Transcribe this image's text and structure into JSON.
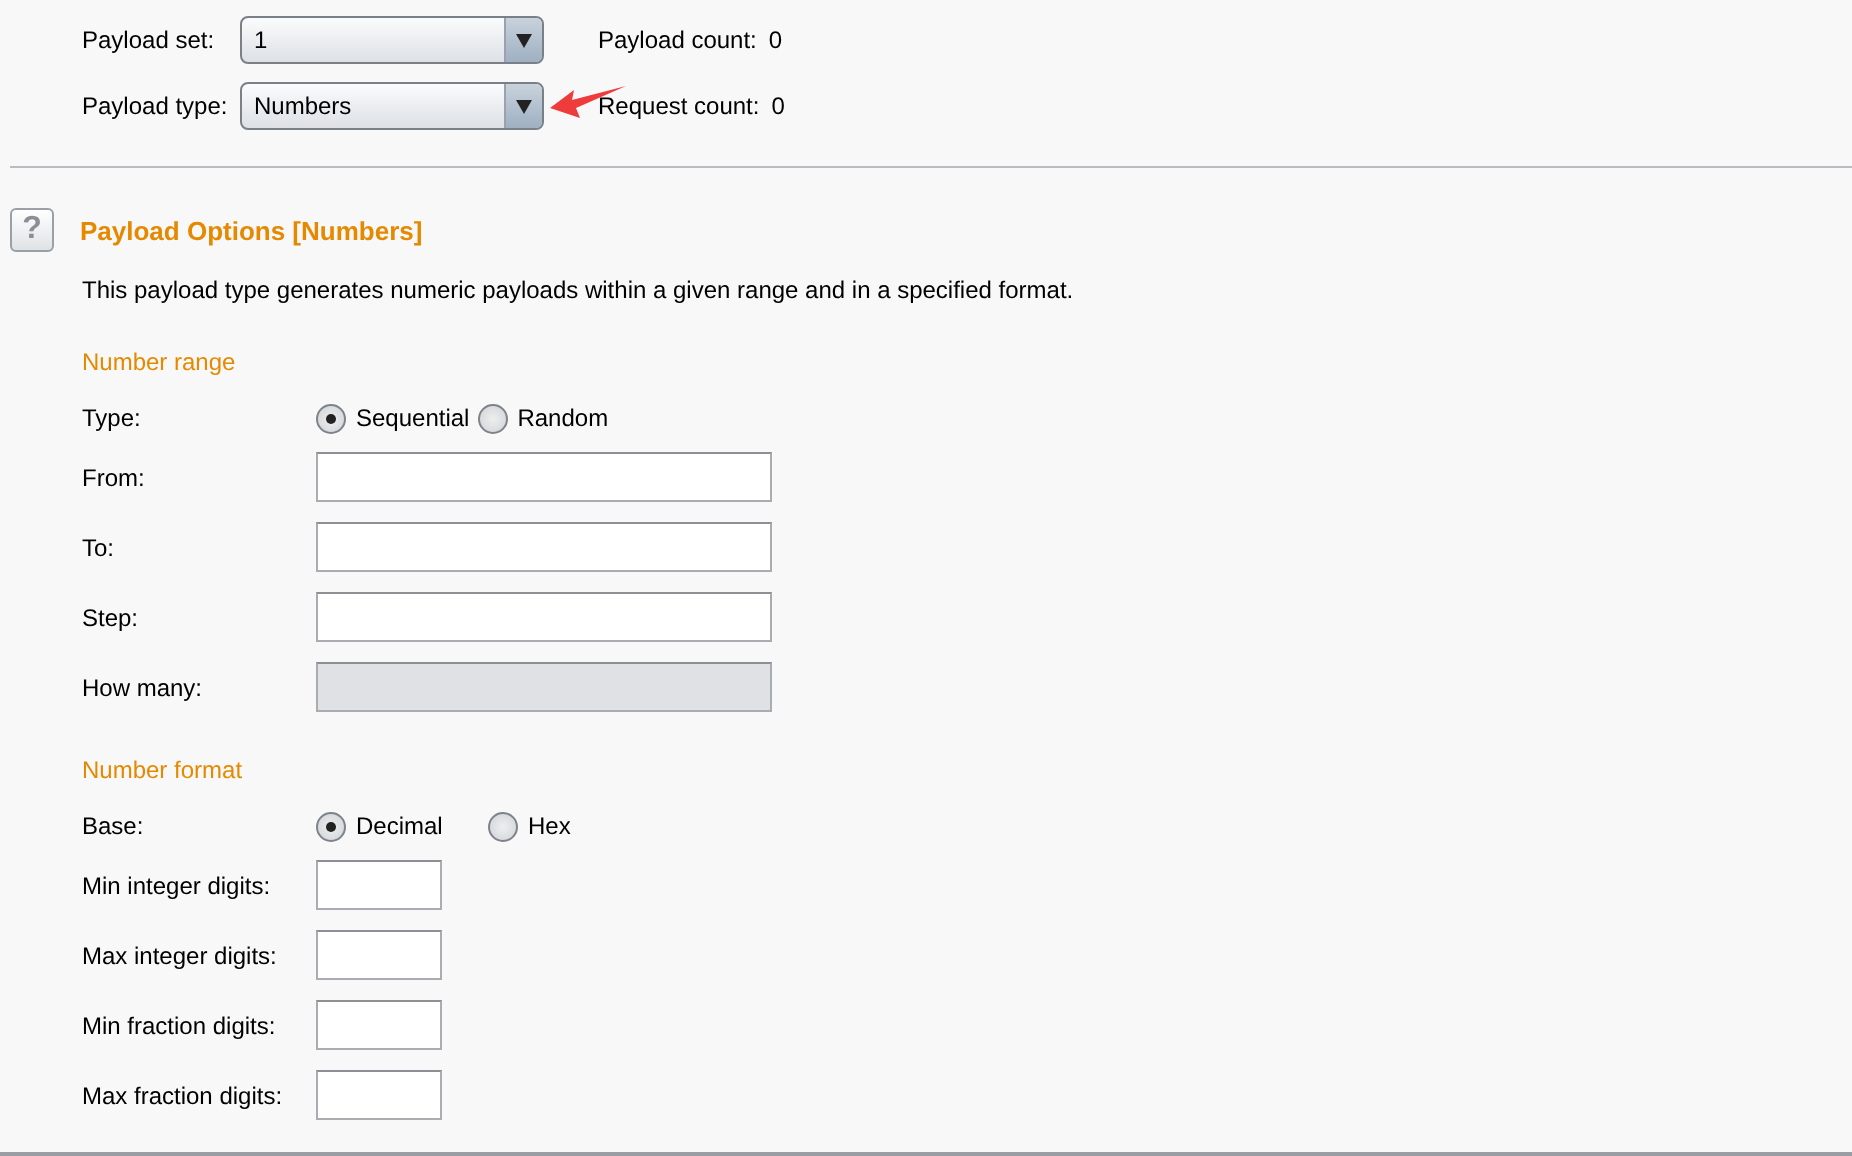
{
  "top": [
    {
      "label": "Payload set:",
      "value": "1",
      "count": "Payload count:",
      "count_value": "0",
      "annotated": false
    },
    {
      "label": "Payload type:",
      "value": "Numbers",
      "count": "Request count:",
      "count_value": "0",
      "annotated": true
    }
  ],
  "help_icon": "?",
  "title": "Payload Options [Numbers]",
  "description": "This payload type generates numeric payloads within a given range and in a specified format.",
  "sections": [
    {
      "heading": "Number range",
      "radio_label": "Type:",
      "kind": "range",
      "options": [
        {
          "label": "Sequential",
          "selected": true
        },
        {
          "label": "Random",
          "selected": false
        }
      ],
      "fields": [
        {
          "label": "From:",
          "disabled": false
        },
        {
          "label": "To:",
          "disabled": false
        },
        {
          "label": "Step:",
          "disabled": false
        },
        {
          "label": "How many:",
          "disabled": true
        }
      ]
    },
    {
      "heading": "Number format",
      "radio_label": "Base:",
      "kind": "digits",
      "options": [
        {
          "label": "Decimal",
          "selected": true
        },
        {
          "label": "Hex",
          "selected": false
        }
      ],
      "fields": [
        {
          "label": "Min integer digits:",
          "disabled": false
        },
        {
          "label": "Max integer digits:",
          "disabled": false
        },
        {
          "label": "Min fraction digits:",
          "disabled": false
        },
        {
          "label": "Max fraction digits:",
          "disabled": false
        }
      ]
    }
  ]
}
